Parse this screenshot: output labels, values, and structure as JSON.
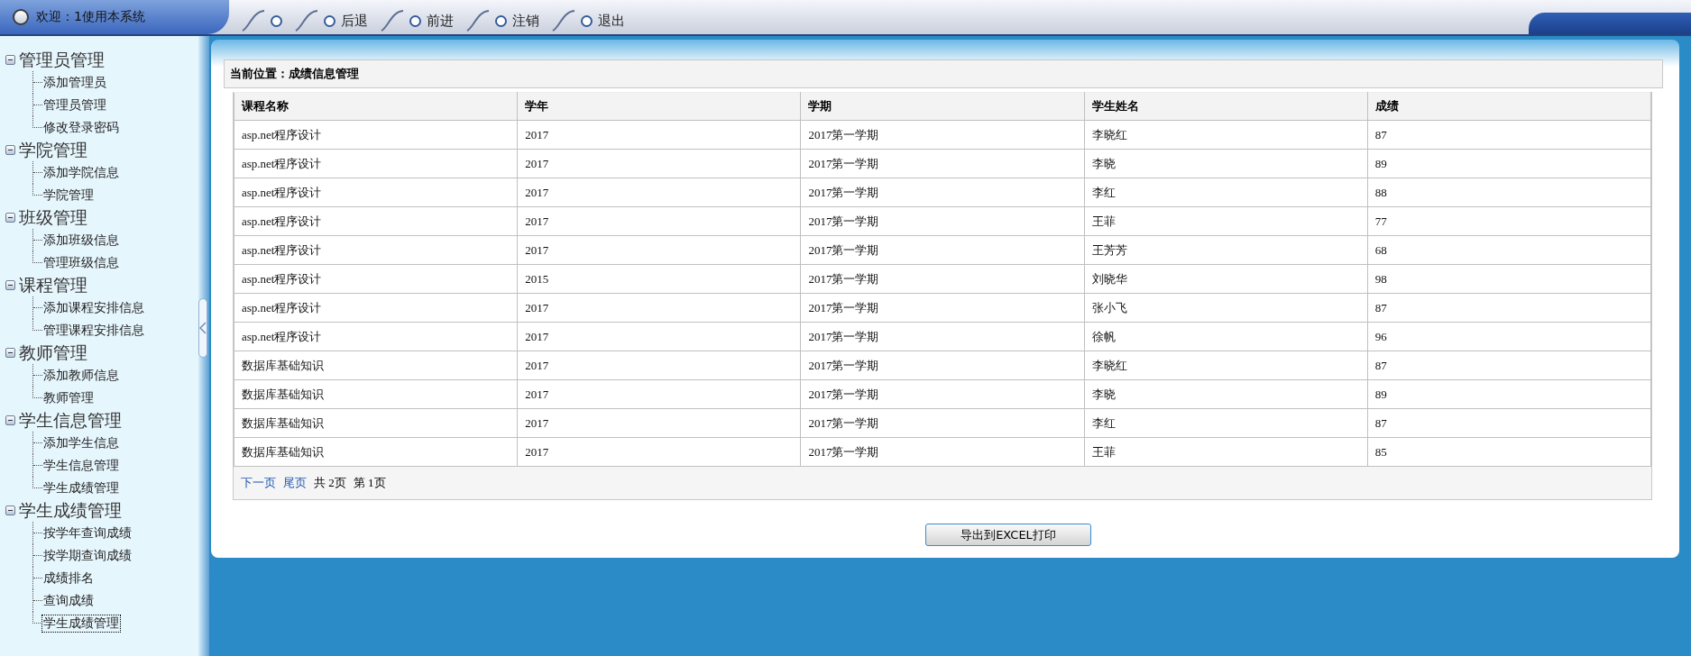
{
  "header": {
    "welcome": "欢迎：1使用本系统",
    "nav": [
      {
        "kind": "icon"
      },
      {
        "kind": "text",
        "label": "后退"
      },
      {
        "kind": "text",
        "label": "前进"
      },
      {
        "kind": "text",
        "label": "注销"
      },
      {
        "kind": "text",
        "label": "退出"
      }
    ]
  },
  "sidebar": {
    "groups": [
      {
        "label": "管理员管理",
        "expanded": true,
        "children": [
          {
            "label": "添加管理员",
            "selected": false
          },
          {
            "label": "管理员管理",
            "selected": false
          },
          {
            "label": "修改登录密码",
            "selected": false
          }
        ]
      },
      {
        "label": "学院管理",
        "expanded": true,
        "children": [
          {
            "label": "添加学院信息",
            "selected": false
          },
          {
            "label": "学院管理",
            "selected": false
          }
        ]
      },
      {
        "label": "班级管理",
        "expanded": true,
        "children": [
          {
            "label": "添加班级信息",
            "selected": false
          },
          {
            "label": "管理班级信息",
            "selected": false
          }
        ]
      },
      {
        "label": "课程管理",
        "expanded": true,
        "children": [
          {
            "label": "添加课程安排信息",
            "selected": false
          },
          {
            "label": "管理课程安排信息",
            "selected": false
          }
        ]
      },
      {
        "label": "教师管理",
        "expanded": true,
        "children": [
          {
            "label": "添加教师信息",
            "selected": false
          },
          {
            "label": "教师管理",
            "selected": false
          }
        ]
      },
      {
        "label": "学生信息管理",
        "expanded": true,
        "children": [
          {
            "label": "添加学生信息",
            "selected": false
          },
          {
            "label": "学生信息管理",
            "selected": false
          },
          {
            "label": "学生成绩管理",
            "selected": false
          }
        ]
      },
      {
        "label": "学生成绩管理",
        "expanded": true,
        "children": [
          {
            "label": "按学年查询成绩",
            "selected": false
          },
          {
            "label": "按学期查询成绩",
            "selected": false
          },
          {
            "label": "成绩排名",
            "selected": false
          },
          {
            "label": "查询成绩",
            "selected": false
          },
          {
            "label": "学生成绩管理",
            "selected": true
          }
        ]
      }
    ]
  },
  "breadcrumb": "当前位置：成绩信息管理",
  "table": {
    "columns": [
      "课程名称",
      "学年",
      "学期",
      "学生姓名",
      "成绩"
    ],
    "rows": [
      [
        "asp.net程序设计",
        "2017",
        "2017第一学期",
        "李晓红",
        "87"
      ],
      [
        "asp.net程序设计",
        "2017",
        "2017第一学期",
        "李晓",
        "89"
      ],
      [
        "asp.net程序设计",
        "2017",
        "2017第一学期",
        "李红",
        "88"
      ],
      [
        "asp.net程序设计",
        "2017",
        "2017第一学期",
        "王菲",
        "77"
      ],
      [
        "asp.net程序设计",
        "2017",
        "2017第一学期",
        "王芳芳",
        "68"
      ],
      [
        "asp.net程序设计",
        "2015",
        "2017第一学期",
        "刘晓华",
        "98"
      ],
      [
        "asp.net程序设计",
        "2017",
        "2017第一学期",
        "张小飞",
        "87"
      ],
      [
        "asp.net程序设计",
        "2017",
        "2017第一学期",
        "徐帆",
        "96"
      ],
      [
        "数据库基础知识",
        "2017",
        "2017第一学期",
        "李晓红",
        "87"
      ],
      [
        "数据库基础知识",
        "2017",
        "2017第一学期",
        "李晓",
        "89"
      ],
      [
        "数据库基础知识",
        "2017",
        "2017第一学期",
        "李红",
        "87"
      ],
      [
        "数据库基础知识",
        "2017",
        "2017第一学期",
        "王菲",
        "85"
      ]
    ]
  },
  "pager": {
    "next": "下一页",
    "last": "尾页",
    "total": "共 2页",
    "current": "第 1页"
  },
  "export_button": "导出到EXCEL打印"
}
